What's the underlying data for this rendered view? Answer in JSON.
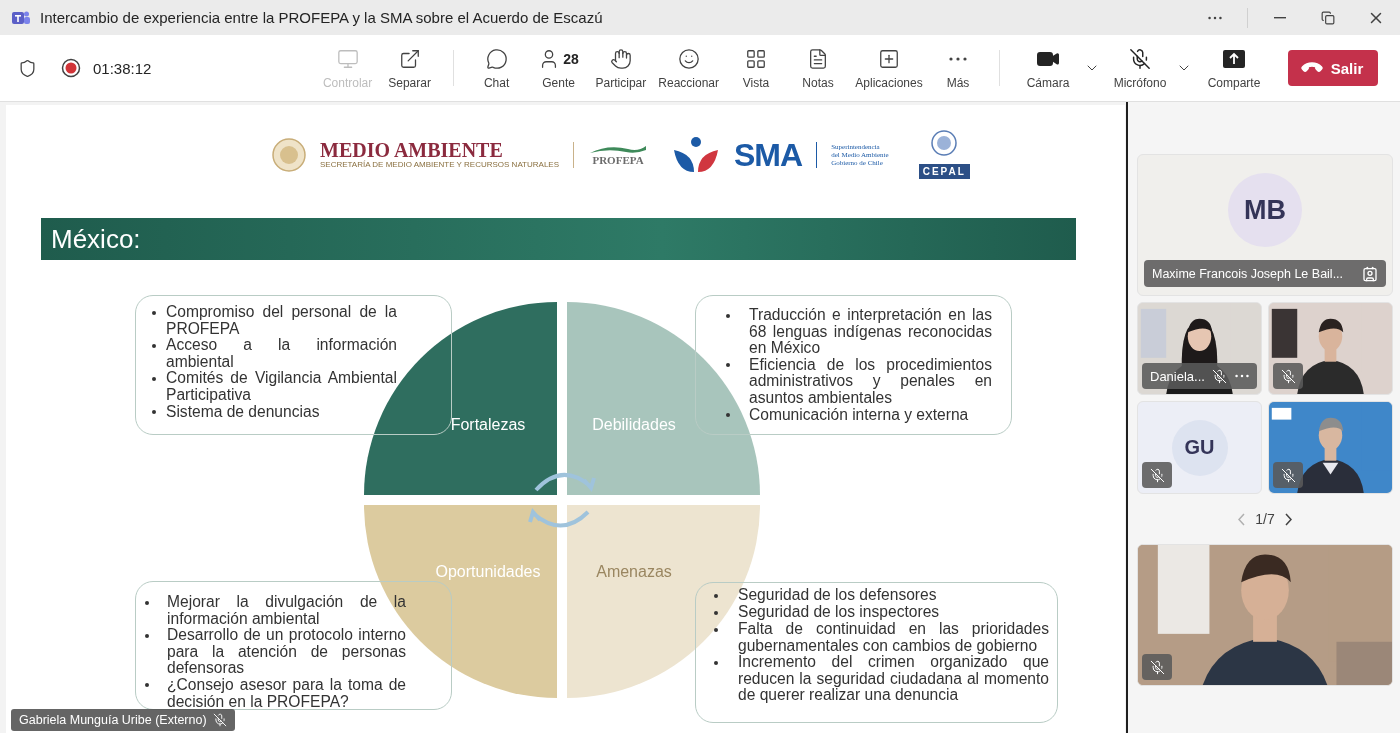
{
  "window": {
    "title": "Intercambio de experiencia entre la PROFEPA y la SMA sobre el Acuerdo de Escazú"
  },
  "toolbar": {
    "recording": true,
    "timer": "01:38:12",
    "buttons": [
      {
        "label": "Controlar",
        "disabled": true
      },
      {
        "label": "Separar",
        "disabled": false
      },
      {
        "label": "Chat",
        "disabled": false
      },
      {
        "label": "Gente",
        "disabled": false,
        "count": "28"
      },
      {
        "label": "Participar",
        "disabled": false
      },
      {
        "label": "Reaccionar",
        "disabled": false
      },
      {
        "label": "Vista",
        "disabled": false
      },
      {
        "label": "Notas",
        "disabled": false
      },
      {
        "label": "Aplicaciones",
        "disabled": false
      },
      {
        "label": "Más",
        "disabled": false
      }
    ],
    "devices": [
      {
        "label": "Cámara",
        "on": true
      },
      {
        "label": "Micrófono",
        "on": false
      }
    ],
    "share": {
      "label": "Comparte"
    },
    "leave": {
      "label": "Salir"
    }
  },
  "slide": {
    "logos": {
      "ministry": "MEDIO AMBIENTE",
      "ministry_sub": "SECRETARÍA DE MEDIO AMBIENTE Y RECURSOS NATURALES",
      "agency": "PROFEPA",
      "sma": "SMA",
      "sma_sub": [
        "Superintendencia",
        "del Medio Ambiente",
        "Gobierno de Chile"
      ],
      "cepal": "CEPAL"
    },
    "heading": "México:",
    "quadrants": [
      {
        "label": "Fortalezas",
        "color": "#2f6e5f"
      },
      {
        "label": "Debilidades",
        "color": "#a8c5bc"
      },
      {
        "label": "Oportunidades",
        "color": "#dccb9f"
      },
      {
        "label": "Amenazas",
        "color": "#ede4d0"
      }
    ],
    "boxes": [
      {
        "items": [
          "Compromiso del personal de la PROFEPA",
          "Acceso a la información ambiental",
          "Comités de Vigilancia Ambiental Participativa",
          "Sistema de denuncias"
        ]
      },
      {
        "items": [
          "Traducción e interpretación en las 68 lenguas indígenas reconocidas en México",
          "Eficiencia de los procedimientos administrativos y penales en asuntos ambientales",
          "Comunicación interna y externa"
        ]
      },
      {
        "items": [
          "Mejorar la divulgación de la información ambiental",
          "Desarrollo de un protocolo interno para la atención de personas defensoras",
          "¿Consejo asesor para la toma de decisión en la PROFEPA?"
        ]
      },
      {
        "items": [
          "Seguridad de los defensores",
          "Seguridad de los inspectores",
          "Falta de continuidad en las prioridades gubernamentales con cambios de gobierno",
          "Incremento del crimen organizado que reducen la seguridad ciudadana al momento de querer realizar una denuncia"
        ]
      }
    ]
  },
  "presenter": {
    "name": "Gabriela Munguía Uribe (Externo)",
    "muted": true
  },
  "participants": {
    "featured": {
      "initials": "MB",
      "name": "Maxime Francois Joseph Le Bail..."
    },
    "tiles": [
      {
        "kind": "video",
        "name": "Daniela...",
        "muted": true
      },
      {
        "kind": "video",
        "muted": true
      },
      {
        "kind": "avatar",
        "initials": "GU",
        "muted": true
      },
      {
        "kind": "video",
        "muted": true
      }
    ],
    "pager": "1/7",
    "self": {
      "muted": true
    }
  }
}
